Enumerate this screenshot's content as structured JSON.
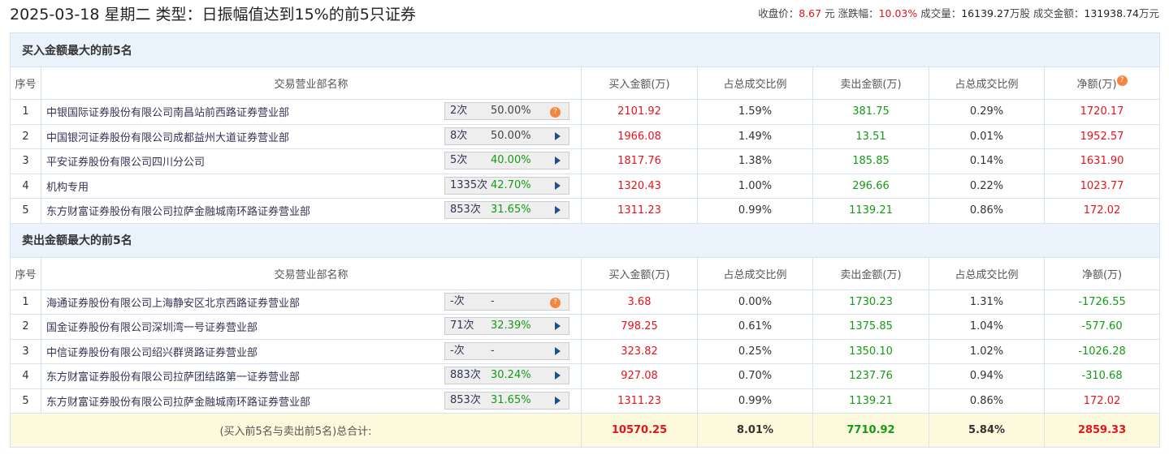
{
  "title": "2025-03-18 星期二 类型：日振幅值达到15%的前5只证券",
  "stats": {
    "close_label": "收盘价：",
    "close": "8.67",
    "close_unit": " 元 ",
    "chg_label": "涨跌幅：",
    "chg": "10.03%",
    "vol_label": " 成交量：",
    "vol": "16139.27",
    "vol_unit": "万股 ",
    "amt_label": "成交金额：",
    "amt": "131938.74",
    "amt_unit": "万元"
  },
  "headers": [
    "序号",
    "交易营业部名称",
    "买入金额(万)",
    "占总成交比例",
    "卖出金额(万)",
    "占总成交比例",
    "净额(万)"
  ],
  "buy_section": {
    "title": "买入金额最大的前5名",
    "rows": [
      {
        "no": "1",
        "name": "中银国际证券股份有限公司南昌站前西路证券营业部",
        "count": "2次",
        "pct": "50.00%",
        "pct_color": "gray",
        "icon": "question",
        "buy": "2101.92",
        "buy_pct": "1.59%",
        "sell": "381.75",
        "sell_pct": "0.29%",
        "net": "1720.17",
        "net_color": "red"
      },
      {
        "no": "2",
        "name": "中国银河证券股份有限公司成都益州大道证券营业部",
        "count": "8次",
        "pct": "50.00%",
        "pct_color": "gray",
        "icon": "arrow",
        "buy": "1966.08",
        "buy_pct": "1.49%",
        "sell": "13.51",
        "sell_pct": "0.01%",
        "net": "1952.57",
        "net_color": "red"
      },
      {
        "no": "3",
        "name": "平安证券股份有限公司四川分公司",
        "count": "5次",
        "pct": "40.00%",
        "pct_color": "green",
        "icon": "arrow",
        "buy": "1817.76",
        "buy_pct": "1.38%",
        "sell": "185.85",
        "sell_pct": "0.14%",
        "net": "1631.90",
        "net_color": "red"
      },
      {
        "no": "4",
        "name": "机构专用",
        "count": "1335次",
        "pct": "42.70%",
        "pct_color": "green",
        "icon": "arrow",
        "buy": "1320.43",
        "buy_pct": "1.00%",
        "sell": "296.66",
        "sell_pct": "0.22%",
        "net": "1023.77",
        "net_color": "red"
      },
      {
        "no": "5",
        "name": "东方财富证券股份有限公司拉萨金融城南环路证券营业部",
        "count": "853次",
        "pct": "31.65%",
        "pct_color": "green",
        "icon": "arrow",
        "buy": "1311.23",
        "buy_pct": "0.99%",
        "sell": "1139.21",
        "sell_pct": "0.86%",
        "net": "172.02",
        "net_color": "red"
      }
    ]
  },
  "sell_section": {
    "title": "卖出金额最大的前5名",
    "rows": [
      {
        "no": "1",
        "name": "海通证券股份有限公司上海静安区北京西路证券营业部",
        "count": "-次",
        "pct": "-",
        "pct_color": "gray",
        "icon": "question",
        "buy": "3.68",
        "buy_pct": "0.00%",
        "sell": "1730.23",
        "sell_pct": "1.31%",
        "net": "-1726.55",
        "net_color": "green"
      },
      {
        "no": "2",
        "name": "国金证券股份有限公司深圳湾一号证券营业部",
        "count": "71次",
        "pct": "32.39%",
        "pct_color": "green",
        "icon": "arrow",
        "buy": "798.25",
        "buy_pct": "0.61%",
        "sell": "1375.85",
        "sell_pct": "1.04%",
        "net": "-577.60",
        "net_color": "green"
      },
      {
        "no": "3",
        "name": "中信证券股份有限公司绍兴群贤路证券营业部",
        "count": "-次",
        "pct": "-",
        "pct_color": "gray",
        "icon": "arrow",
        "buy": "323.82",
        "buy_pct": "0.25%",
        "sell": "1350.10",
        "sell_pct": "1.02%",
        "net": "-1026.28",
        "net_color": "green"
      },
      {
        "no": "4",
        "name": "东方财富证券股份有限公司拉萨团结路第一证券营业部",
        "count": "883次",
        "pct": "30.24%",
        "pct_color": "green",
        "icon": "arrow",
        "buy": "927.08",
        "buy_pct": "0.70%",
        "sell": "1237.76",
        "sell_pct": "0.94%",
        "net": "-310.68",
        "net_color": "green"
      },
      {
        "no": "5",
        "name": "东方财富证券股份有限公司拉萨金融城南环路证券营业部",
        "count": "853次",
        "pct": "31.65%",
        "pct_color": "green",
        "icon": "arrow",
        "buy": "1311.23",
        "buy_pct": "0.99%",
        "sell": "1139.21",
        "sell_pct": "0.86%",
        "net": "172.02",
        "net_color": "red"
      }
    ]
  },
  "total": {
    "label": "(买入前5名与卖出前5名)总合计:",
    "buy": "10570.25",
    "buy_pct": "8.01%",
    "sell": "7710.92",
    "sell_pct": "5.84%",
    "net": "2859.33"
  }
}
